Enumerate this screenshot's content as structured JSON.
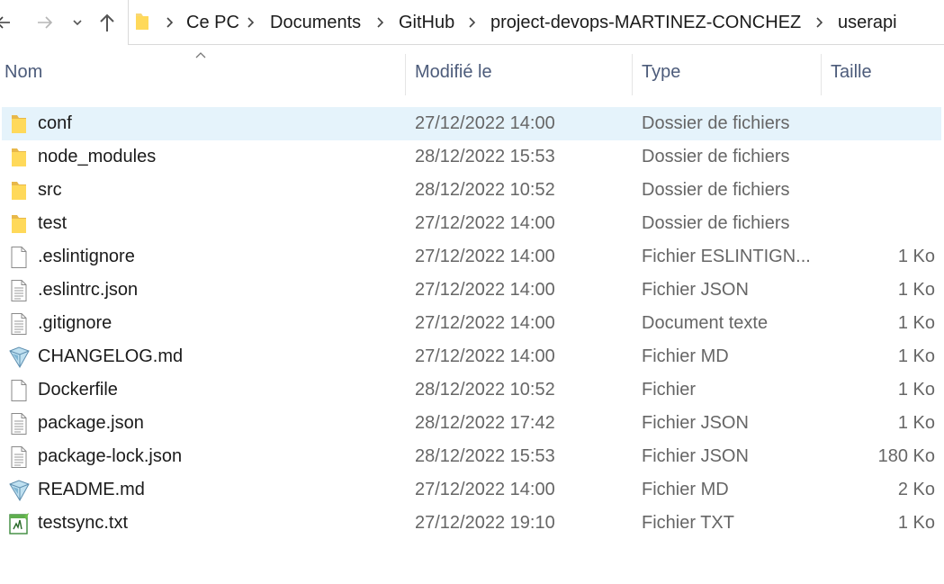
{
  "breadcrumb": [
    "Ce PC",
    "Documents",
    "GitHub",
    "project-devops-MARTINEZ-CONCHEZ",
    "userapi"
  ],
  "columns": {
    "name": "Nom",
    "modified": "Modifié le",
    "type": "Type",
    "size": "Taille"
  },
  "files": [
    {
      "name": "conf",
      "date": "27/12/2022 14:00",
      "type": "Dossier de fichiers",
      "size": "",
      "icon": "folder-icon",
      "selected": true
    },
    {
      "name": "node_modules",
      "date": "28/12/2022 15:53",
      "type": "Dossier de fichiers",
      "size": "",
      "icon": "folder-icon"
    },
    {
      "name": "src",
      "date": "28/12/2022 10:52",
      "type": "Dossier de fichiers",
      "size": "",
      "icon": "folder-icon"
    },
    {
      "name": "test",
      "date": "27/12/2022 14:00",
      "type": "Dossier de fichiers",
      "size": "",
      "icon": "folder-icon"
    },
    {
      "name": ".eslintignore",
      "date": "27/12/2022 14:00",
      "type": "Fichier ESLINTIGN...",
      "size": "1 Ko",
      "icon": "blank-file-icon"
    },
    {
      "name": ".eslintrc.json",
      "date": "27/12/2022 14:00",
      "type": "Fichier JSON",
      "size": "1 Ko",
      "icon": "text-file-icon"
    },
    {
      "name": ".gitignore",
      "date": "27/12/2022 14:00",
      "type": "Document texte",
      "size": "1 Ko",
      "icon": "text-file-icon"
    },
    {
      "name": "CHANGELOG.md",
      "date": "27/12/2022 14:00",
      "type": "Fichier MD",
      "size": "1 Ko",
      "icon": "markdown-file-icon"
    },
    {
      "name": "Dockerfile",
      "date": "28/12/2022 10:52",
      "type": "Fichier",
      "size": "1 Ko",
      "icon": "blank-file-icon"
    },
    {
      "name": "package.json",
      "date": "28/12/2022 17:42",
      "type": "Fichier JSON",
      "size": "1 Ko",
      "icon": "text-file-icon"
    },
    {
      "name": "package-lock.json",
      "date": "28/12/2022 15:53",
      "type": "Fichier JSON",
      "size": "180 Ko",
      "icon": "text-file-icon"
    },
    {
      "name": "README.md",
      "date": "27/12/2022 14:00",
      "type": "Fichier MD",
      "size": "2 Ko",
      "icon": "markdown-file-icon"
    },
    {
      "name": "testsync.txt",
      "date": "27/12/2022 19:10",
      "type": "Fichier TXT",
      "size": "1 Ko",
      "icon": "notepad-file-icon"
    }
  ],
  "colors": {
    "selection": "#e5f3fb",
    "header_text": "#4c5b7a",
    "folder_yellow": "#f8d775"
  }
}
